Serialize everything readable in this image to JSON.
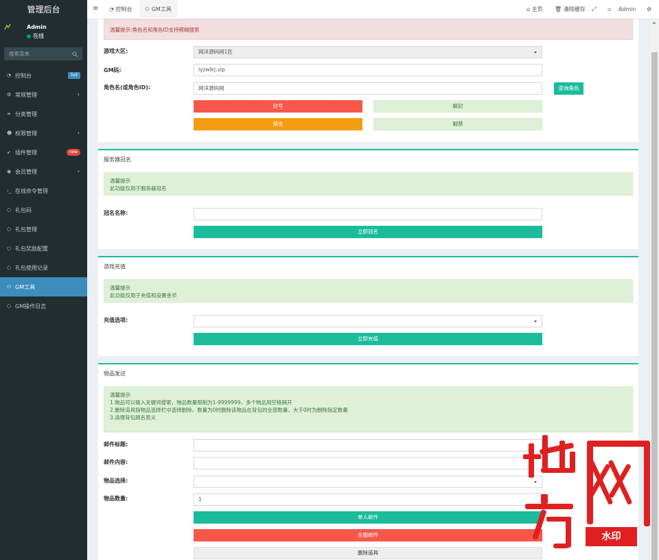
{
  "brand": "管理后台",
  "user": {
    "name": "Admin",
    "status": "在线"
  },
  "sidebar": {
    "search_placeholder": "搜索菜单",
    "items": [
      {
        "label": "控制台",
        "icon": "dashboard-icon",
        "badge": "hot"
      },
      {
        "label": "常规管理",
        "icon": "cogs-icon",
        "chevron": true
      },
      {
        "label": "分类管理",
        "icon": "leaf-icon"
      },
      {
        "label": "权限管理",
        "icon": "group-icon",
        "chevron": true
      },
      {
        "label": "插件管理",
        "icon": "rocket-icon",
        "badge": "new"
      },
      {
        "label": "会员管理",
        "icon": "user-circle-icon",
        "chevron": true
      },
      {
        "label": "在线命令管理",
        "icon": "terminal-icon"
      },
      {
        "label": "礼包码",
        "icon": "circle-icon"
      },
      {
        "label": "礼包管理",
        "icon": "circle-icon"
      },
      {
        "label": "礼包奖励配置",
        "icon": "circle-icon"
      },
      {
        "label": "礼包使用记录",
        "icon": "circle-icon"
      },
      {
        "label": "GM工具",
        "icon": "gamepad-icon",
        "active": true
      },
      {
        "label": "GM操作日志",
        "icon": "circle-icon"
      }
    ]
  },
  "header": {
    "tabs": [
      {
        "label": "控制台"
      },
      {
        "label": "GM工具"
      }
    ],
    "home": "主页",
    "clear_cache": "清除缓存",
    "admin": "Admin"
  },
  "role_section": {
    "alert": "温馨提示:角色名和角色ID支持模糊搜索",
    "zone_label": "游戏大区:",
    "zone_value": "网洋源码网1区",
    "gm_label": "GM码:",
    "gm_value": "lyzwlkj.vip",
    "role_label": "角色名(或角色ID):",
    "role_value": "网洋源码网",
    "query_button": "查询角色",
    "ban_button": "封号",
    "unban_button": "解封",
    "mute_button": "禁言",
    "unmute_button": "解禁"
  },
  "title_section": {
    "title": "服务器冠名",
    "alert_title": "温馨提示",
    "alert_text": "此功能仅用于服务器冠名",
    "name_label": "冠名名称:",
    "name_value": "",
    "submit": "立即冠名"
  },
  "recharge_section": {
    "title": "游戏充值",
    "alert_title": "温馨提示",
    "alert_text": "此功能仅用于充值和设置金币",
    "option_label": "充值选项:",
    "option_value": "",
    "submit": "立即充值"
  },
  "item_section": {
    "title": "物品发送",
    "alert_title": "温馨提示",
    "alert_lines": [
      "1.物品可以输入关键词搜索，物品数量限制为1-9999999，多个物品用空格隔开",
      "2.删除道具指物品选择栏中选择删除，数量为0时删除该物品在背包的全部数量，大于0时为删除指定数量",
      "3.清理背包顾名思义"
    ],
    "mail_title_label": "邮件标题:",
    "mail_title_value": "",
    "mail_content_label": "邮件内容:",
    "mail_content_value": "",
    "item_select_label": "物品选择:",
    "item_select_value": "",
    "item_qty_label": "物品数量:",
    "item_qty_value": "1",
    "single_mail": "单人邮件",
    "all_mail": "全服邮件",
    "delete_item": "删除道具"
  },
  "watermark": {
    "text": "地方网",
    "stamp": "水印"
  }
}
